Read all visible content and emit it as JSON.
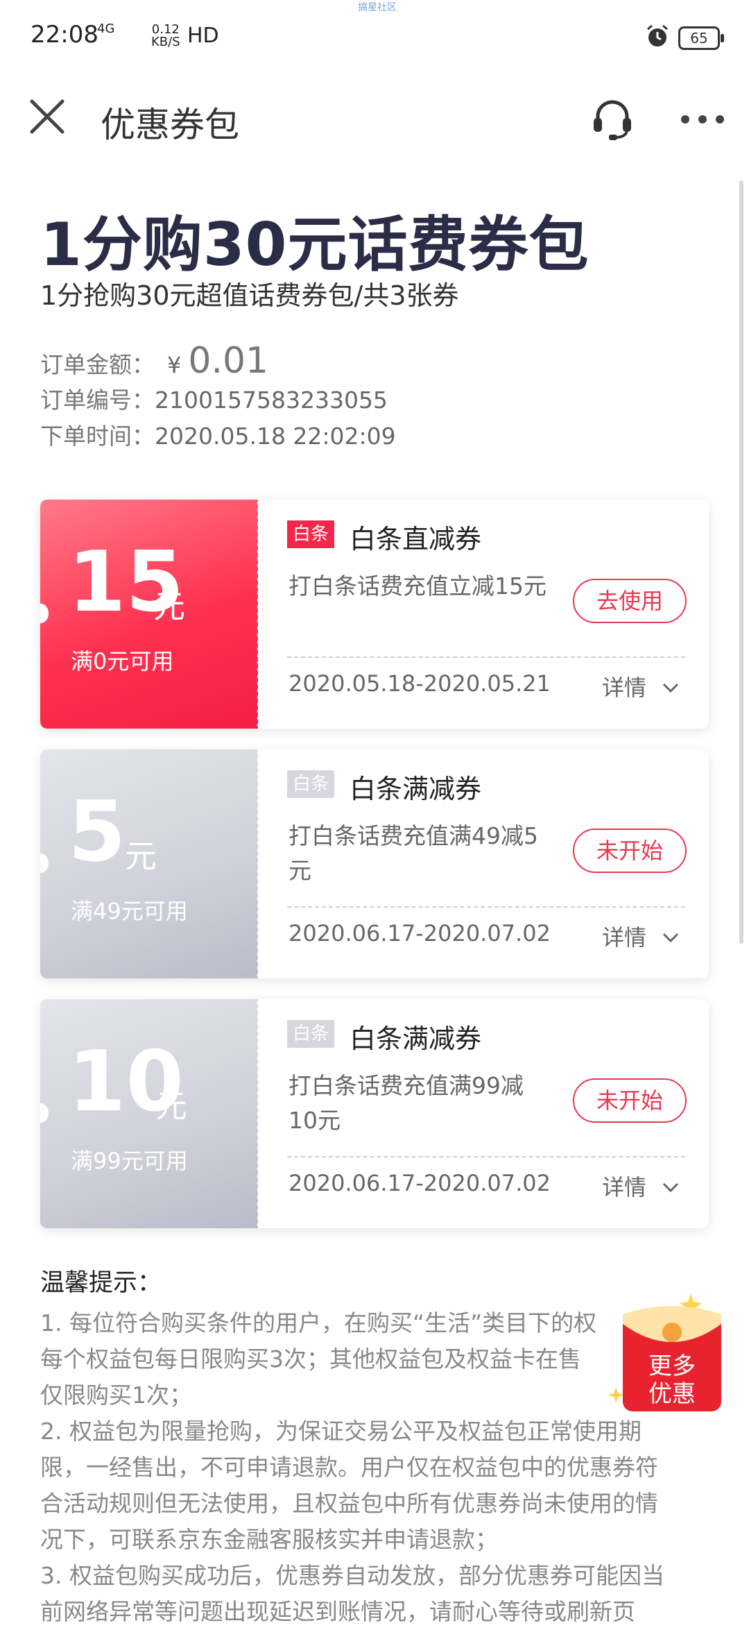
{
  "status": {
    "time": "22:08",
    "signal": "4G",
    "speed_top": "0.12",
    "speed_bottom": "KB/S",
    "hd": "HD",
    "battery": "65",
    "watermark": "搞星社区"
  },
  "nav": {
    "title": "优惠券包"
  },
  "package": {
    "title": "1分购30元话费券包",
    "subtitle": "1分抢购30元超值话费券包/共3张券"
  },
  "order": {
    "amount_label": "订单金额：",
    "currency": "¥",
    "amount": "0.01",
    "number_label": "订单编号：",
    "number": "2100157583233055",
    "time_label": "下单时间：",
    "time": "2020.05.18 22:02:09"
  },
  "coupons": [
    {
      "value": "15",
      "unit": "元",
      "condition": "满0元可用",
      "tag": "白条",
      "name": "白条直减券",
      "desc": "打白条话费充值立减15元",
      "action": "去使用",
      "dates": "2020.05.18-2020.05.21",
      "detail": "详情"
    },
    {
      "value": "5",
      "unit": "元",
      "condition": "满49元可用",
      "tag": "白条",
      "name": "白条满减券",
      "desc": "打白条话费充值满49减5元",
      "action": "未开始",
      "dates": "2020.06.17-2020.07.02",
      "detail": "详情"
    },
    {
      "value": "10",
      "unit": "元",
      "condition": "满99元可用",
      "tag": "白条",
      "name": "白条满减券",
      "desc": "打白条话费充值满99减10元",
      "action": "未开始",
      "dates": "2020.06.17-2020.07.02",
      "detail": "详情"
    }
  ],
  "tips": {
    "title": "温馨提示：",
    "lines": [
      "1. 每位符合购买条件的用户，在购买“生活”类目下的权",
      "每个权益包每日限购买3次；其他权益包及权益卡在售",
      "仅限购买1次；",
      "2. 权益包为限量抢购，为保证交易公平及权益包正常使用期",
      "限，一经售出，不可申请退款。用户仅在权益包中的优惠券符",
      "合活动规则但无法使用，且权益包中所有优惠券尚未使用的情",
      "况下，可联系京东金融客服核实并申请退款；",
      "3. 权益包购买成功后，优惠券自动发放，部分优惠券可能因当",
      "前网络异常等问题出现延迟到账情况，请耐心等待或刷新页"
    ]
  },
  "promo": {
    "line1": "更多",
    "line2": "优惠"
  }
}
